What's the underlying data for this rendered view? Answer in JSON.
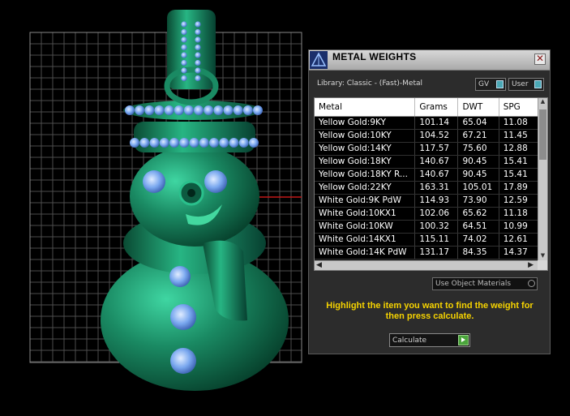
{
  "dialog": {
    "title": "METAL WEIGHTS",
    "close_glyph": "✕",
    "library_label": "Library: Classic - (Fast)-Metal",
    "toggle_gv": "GV",
    "toggle_user": "User",
    "columns": [
      "Metal",
      "Grams",
      "DWT",
      "SPG"
    ],
    "rows": [
      [
        "Yellow Gold:9KY",
        "101.14",
        "65.04",
        "11.08"
      ],
      [
        "Yellow Gold:10KY",
        "104.52",
        "67.21",
        "11.45"
      ],
      [
        "Yellow Gold:14KY",
        "117.57",
        "75.60",
        "12.88"
      ],
      [
        "Yellow Gold:18KY",
        "140.67",
        "90.45",
        "15.41"
      ],
      [
        "Yellow Gold:18KY R...",
        "140.67",
        "90.45",
        "15.41"
      ],
      [
        "Yellow Gold:22KY",
        "163.31",
        "105.01",
        "17.89"
      ],
      [
        "White Gold:9K PdW",
        "114.93",
        "73.90",
        "12.59"
      ],
      [
        "White Gold:10KX1",
        "102.06",
        "65.62",
        "11.18"
      ],
      [
        "White Gold:10KW",
        "100.32",
        "64.51",
        "10.99"
      ],
      [
        "White Gold:14KX1",
        "115.11",
        "74.02",
        "12.61"
      ],
      [
        "White Gold:14K PdW",
        "131.17",
        "84.35",
        "14.37"
      ]
    ],
    "use_object_materials": "Use Object Materials",
    "help_text": "Highlight the item you want to find the weight for then press calculate.",
    "calculate_label": "Calculate"
  },
  "icons": {
    "app_icon": "rhino-pyramid-icon",
    "close_icon": "close-icon",
    "calculate_icon": "play-arrow-icon"
  },
  "colors": {
    "model_green": "#1a8a63",
    "gem_blue": "#7aa8ef",
    "help_yellow": "#f6d300",
    "accent_teal": "#4aa8b5"
  }
}
